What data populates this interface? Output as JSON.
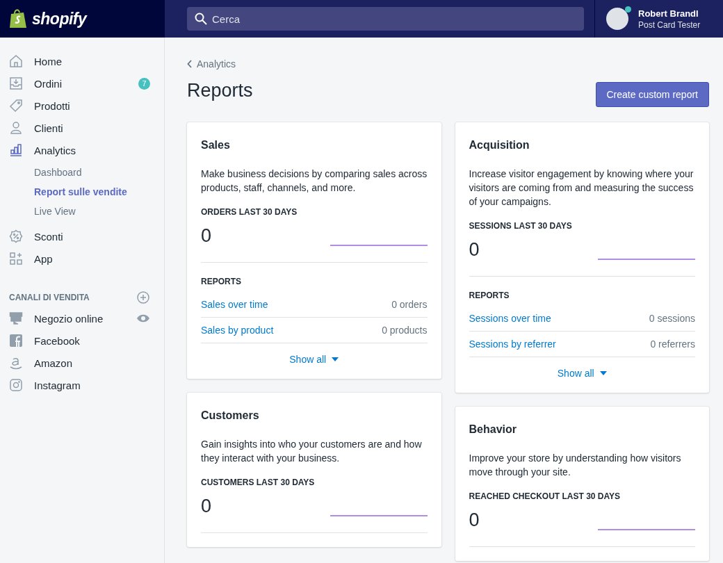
{
  "topbar": {
    "logo": "shopify",
    "search": {
      "placeholder": "Cerca"
    },
    "user": {
      "name": "Robert Brandl",
      "role": "Post Card Tester",
      "online": true
    }
  },
  "sidebar": {
    "items": [
      {
        "label": "Home",
        "kind": "home",
        "selected": false
      },
      {
        "label": "Ordini",
        "kind": "orders",
        "selected": false,
        "badge": "7"
      },
      {
        "label": "Prodotti",
        "kind": "products",
        "selected": false
      },
      {
        "label": "Clienti",
        "kind": "customers",
        "selected": false
      },
      {
        "label": "Analytics",
        "kind": "analytics",
        "selected": true,
        "children": [
          {
            "label": "Dashboard",
            "selected": false
          },
          {
            "label": "Report sulle vendite",
            "selected": true
          },
          {
            "label": "Live View",
            "selected": false
          }
        ]
      },
      {
        "label": "Sconti",
        "kind": "discounts",
        "selected": false
      },
      {
        "label": "App",
        "kind": "apps",
        "selected": false
      }
    ],
    "channels": {
      "heading": "CANALI DI VENDITA",
      "items": [
        {
          "label": "Negozio online",
          "kind": "store",
          "view_button": true
        },
        {
          "label": "Facebook",
          "kind": "facebook",
          "view_button": false
        },
        {
          "label": "Amazon",
          "kind": "amazon",
          "view_button": false
        },
        {
          "label": "Instagram",
          "kind": "instagram",
          "view_button": false
        }
      ]
    }
  },
  "page": {
    "breadcrumb": "Analytics",
    "title": "Reports",
    "primary_button": "Create custom report"
  },
  "columns": [
    [
      {
        "title": "Sales",
        "description": "Make business decisions by comparing sales across products, staff, channels, and more.",
        "metric_label": "ORDERS LAST 30 DAYS",
        "metric_value": "0",
        "reports_heading": "REPORTS",
        "reports": [
          {
            "name": "Sales over time",
            "count": "0 orders"
          },
          {
            "name": "Sales by product",
            "count": "0 products"
          }
        ],
        "show_all": "Show all"
      },
      {
        "title": "Customers",
        "description": "Gain insights into who your customers are and how they interact with your business.",
        "metric_label": "CUSTOMERS LAST 30 DAYS",
        "metric_value": "0"
      }
    ],
    [
      {
        "title": "Acquisition",
        "description": "Increase visitor engagement by knowing where your visitors are coming from and measuring the success of your campaigns.",
        "metric_label": "SESSIONS LAST 30 DAYS",
        "metric_value": "0",
        "reports_heading": "REPORTS",
        "reports": [
          {
            "name": "Sessions over time",
            "count": "0 sessions"
          },
          {
            "name": "Sessions by referrer",
            "count": "0 referrers"
          }
        ],
        "show_all": "Show all"
      },
      {
        "title": "Behavior",
        "description": "Improve your store by understanding how visitors move through your site.",
        "metric_label": "REACHED CHECKOUT LAST 30 DAYS",
        "metric_value": "0"
      }
    ]
  ]
}
